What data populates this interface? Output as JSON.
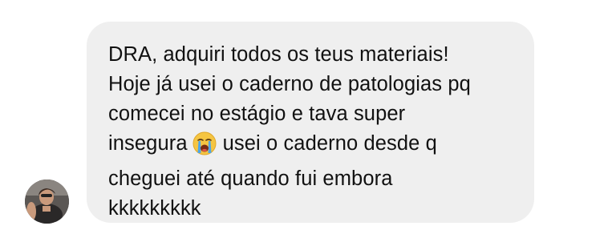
{
  "message": {
    "lines": [
      "DRA, adquiri todos os teus materiais!",
      "Hoje já usei o caderno de patologias pq",
      "comecei no estágio e tava super",
      "insegura",
      "usei o caderno desde q",
      "cheguei até quando fui embora",
      "kkkkkkkkk"
    ],
    "emoji": "loudly-crying-face"
  },
  "avatar": {
    "icon": "user-avatar-photo"
  },
  "colors": {
    "bubble_bg": "#efefef",
    "text": "#111111",
    "background": "#ffffff"
  }
}
